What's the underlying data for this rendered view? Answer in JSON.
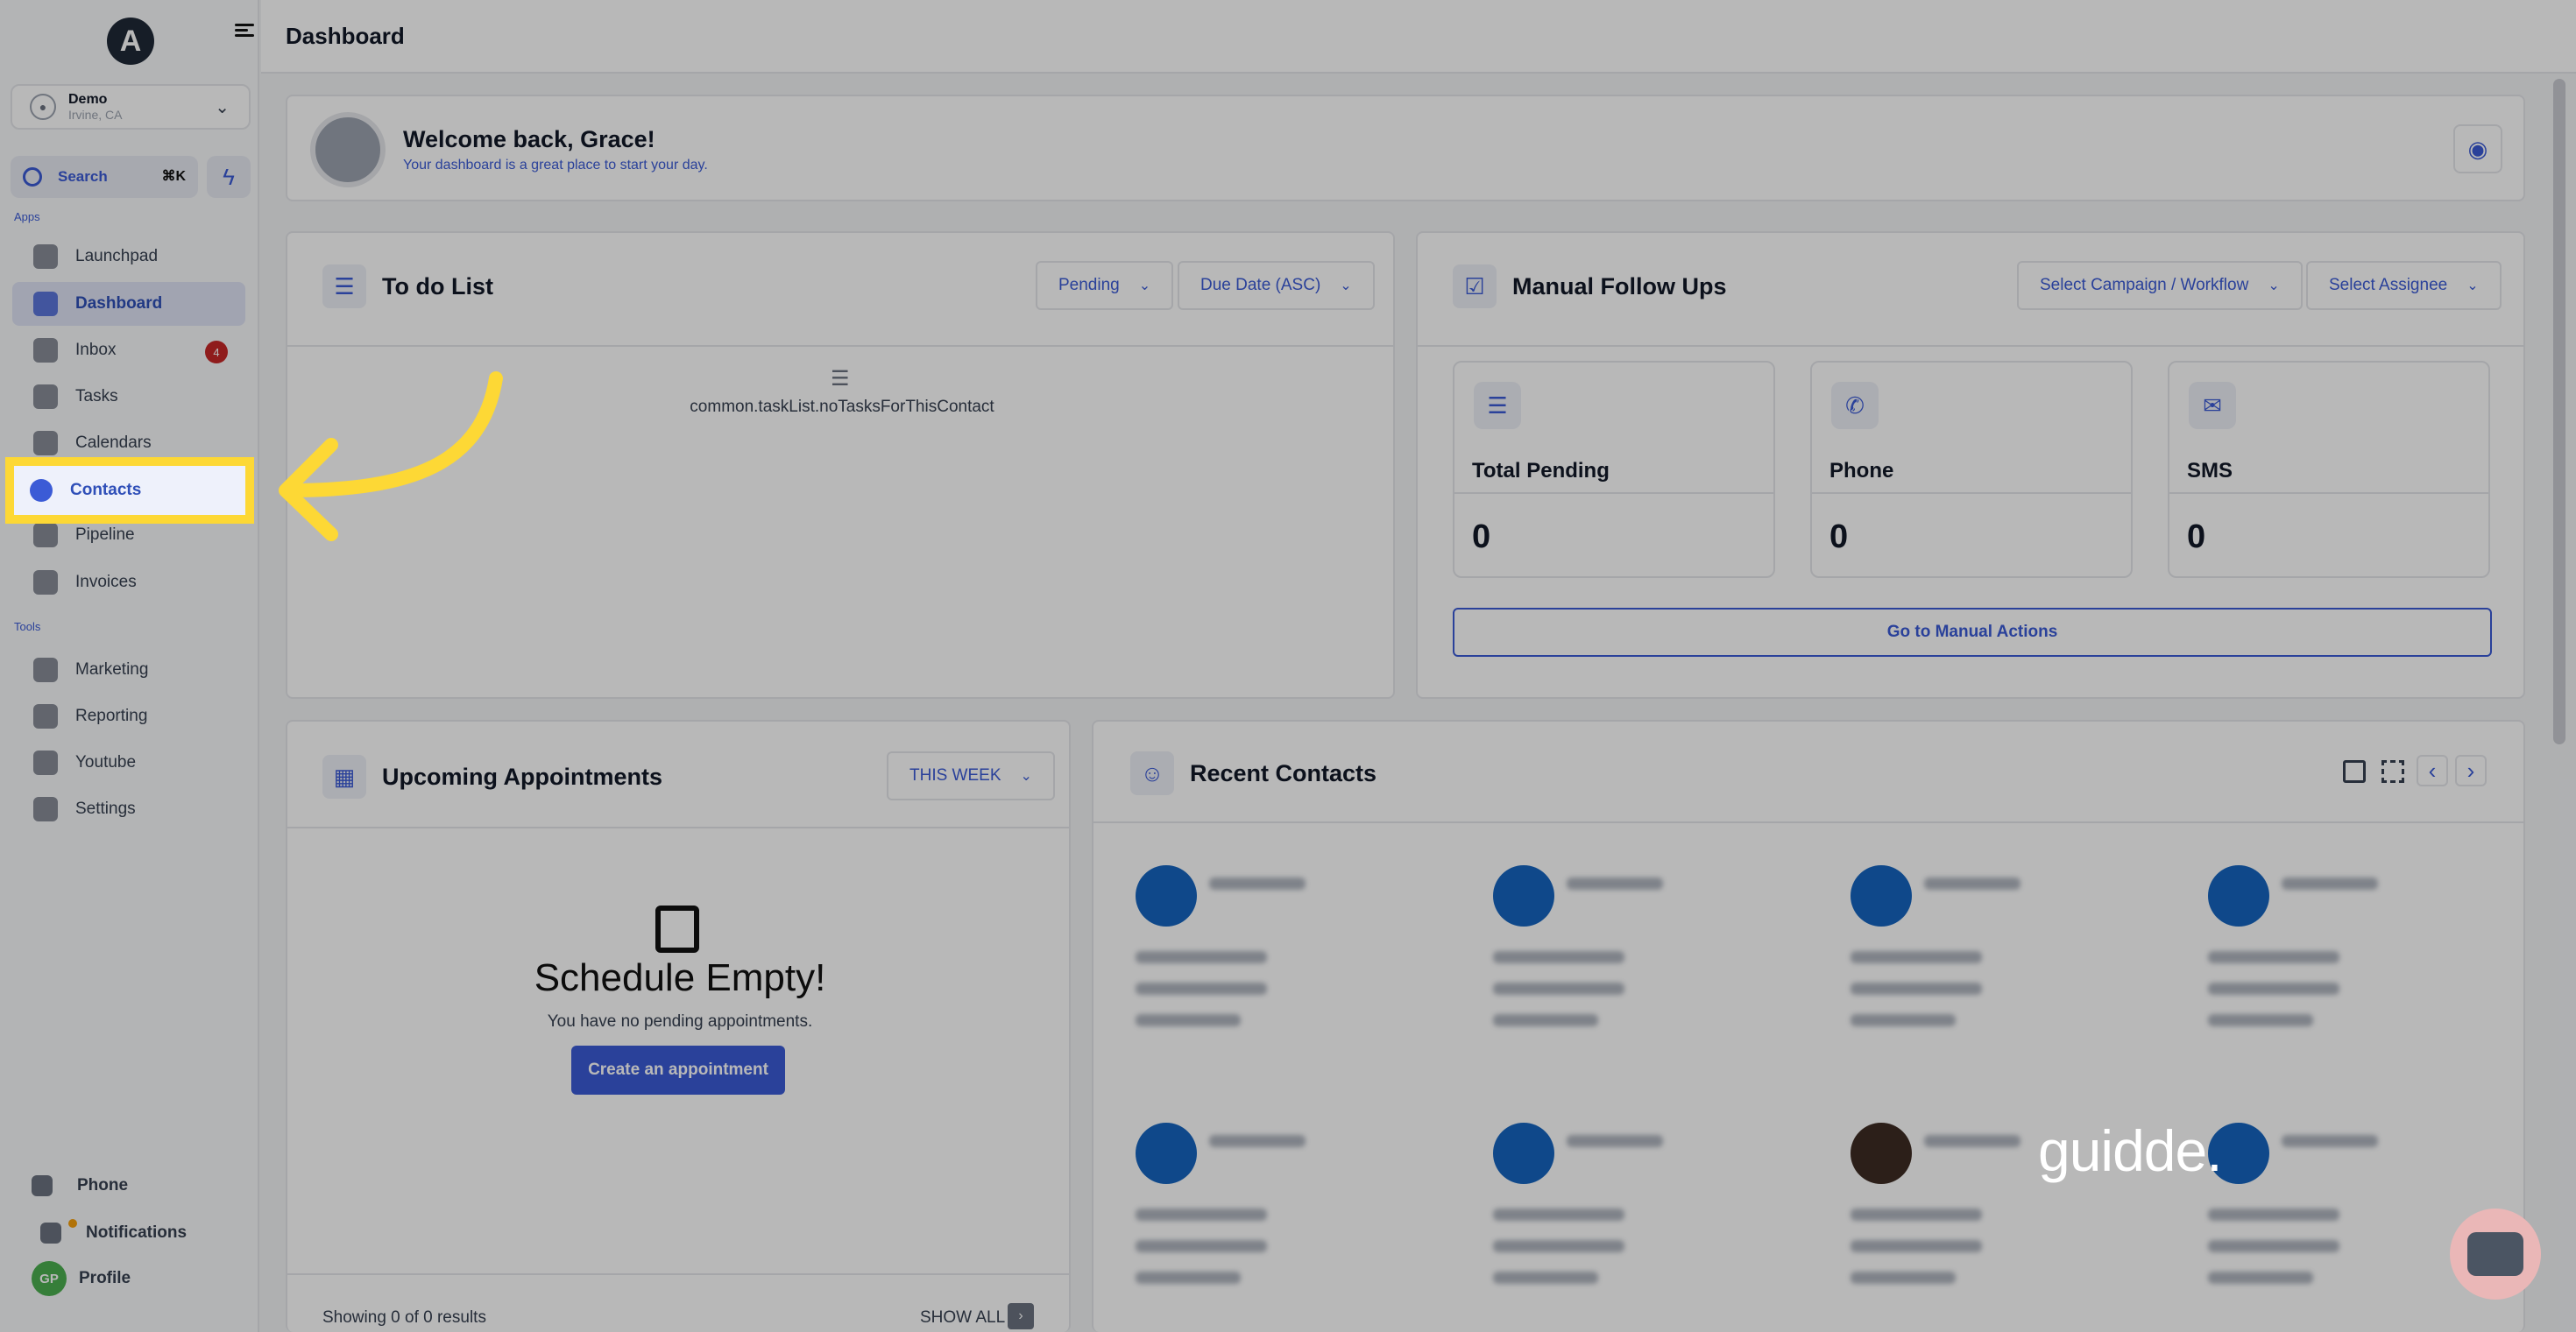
{
  "sidebar": {
    "logo": "A",
    "account": {
      "name": "Demo",
      "location": "Irvine, CA"
    },
    "search": {
      "label": "Search",
      "shortcut": "⌘K"
    },
    "apps_label": "Apps",
    "tools_label": "Tools",
    "apps": [
      {
        "label": "Launchpad",
        "icon": "rocket-icon"
      },
      {
        "label": "Dashboard",
        "icon": "dashboard-icon"
      },
      {
        "label": "Inbox",
        "icon": "inbox-icon",
        "badge": "4"
      },
      {
        "label": "Tasks",
        "icon": "tasks-icon"
      },
      {
        "label": "Calendars",
        "icon": "calendar-icon"
      },
      {
        "label": "Contacts",
        "icon": "contacts-icon"
      },
      {
        "label": "Pipeline",
        "icon": "pipeline-icon"
      },
      {
        "label": "Invoices",
        "icon": "invoice-icon"
      }
    ],
    "tools": [
      {
        "label": "Marketing",
        "icon": "megaphone-icon"
      },
      {
        "label": "Reporting",
        "icon": "pie-chart-icon"
      },
      {
        "label": "Youtube",
        "icon": "youtube-icon"
      },
      {
        "label": "Settings",
        "icon": "gear-icon"
      }
    ],
    "bottom": {
      "phone": "Phone",
      "notifications": "Notifications",
      "profile": "Profile",
      "profile_initials": "GP"
    }
  },
  "header": {
    "title": "Dashboard"
  },
  "welcome": {
    "title": "Welcome back, Grace!",
    "subtitle": "Your dashboard is a great place to start your day."
  },
  "todo": {
    "title": "To do List",
    "filter_status": "Pending",
    "filter_sort": "Due Date (ASC)",
    "empty_text": "common.taskList.noTasksForThisContact"
  },
  "followups": {
    "title": "Manual Follow Ups",
    "campaign_select": "Select Campaign / Workflow",
    "assignee_select": "Select Assignee",
    "stats": [
      {
        "label": "Total Pending",
        "value": "0"
      },
      {
        "label": "Phone",
        "value": "0"
      },
      {
        "label": "SMS",
        "value": "0"
      }
    ],
    "action_button": "Go to Manual Actions"
  },
  "appointments": {
    "title": "Upcoming Appointments",
    "range": "THIS WEEK",
    "empty_title": "Schedule Empty!",
    "empty_text": "You have no pending appointments.",
    "create_button": "Create an appointment",
    "results_text": "Showing 0 of 0 results",
    "show_all": "SHOW ALL"
  },
  "recent_contacts": {
    "title": "Recent Contacts"
  },
  "watermark": "guidde.",
  "colors": {
    "accent": "#3b5bd6",
    "highlight": "#fdd835",
    "badge": "#c62828"
  }
}
